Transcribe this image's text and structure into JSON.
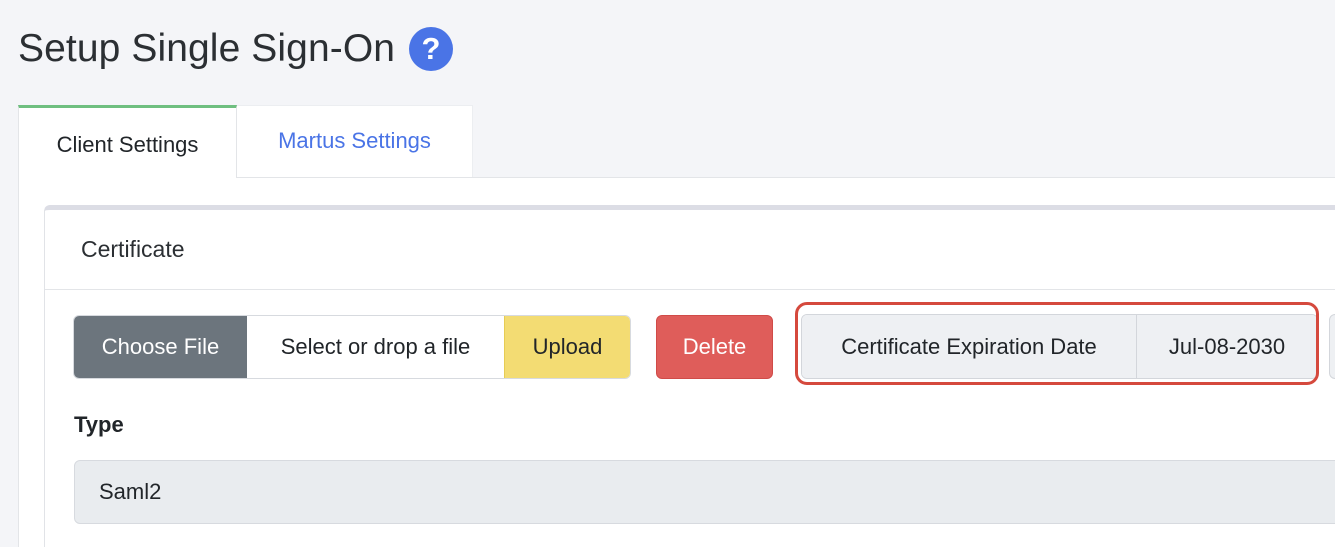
{
  "page": {
    "title": "Setup Single Sign-On",
    "help_icon_glyph": "?"
  },
  "tabs": [
    {
      "label": "Client Settings",
      "active": true
    },
    {
      "label": "Martus Settings",
      "active": false
    }
  ],
  "certificate": {
    "header": "Certificate",
    "choose_file_label": "Choose File",
    "file_placeholder": "Select or drop a file",
    "upload_label": "Upload",
    "delete_label": "Delete",
    "expiration_label": "Certificate Expiration Date",
    "expiration_value": "Jul-08-2030"
  },
  "type": {
    "label": "Type",
    "value": "Saml2"
  },
  "colors": {
    "accent": "#4a74e6",
    "active_tab_border": "#6fbf80",
    "upload": "#f3dc73",
    "delete": "#df5d5a",
    "highlight": "#d5493d",
    "choose_file": "#6c757d"
  }
}
